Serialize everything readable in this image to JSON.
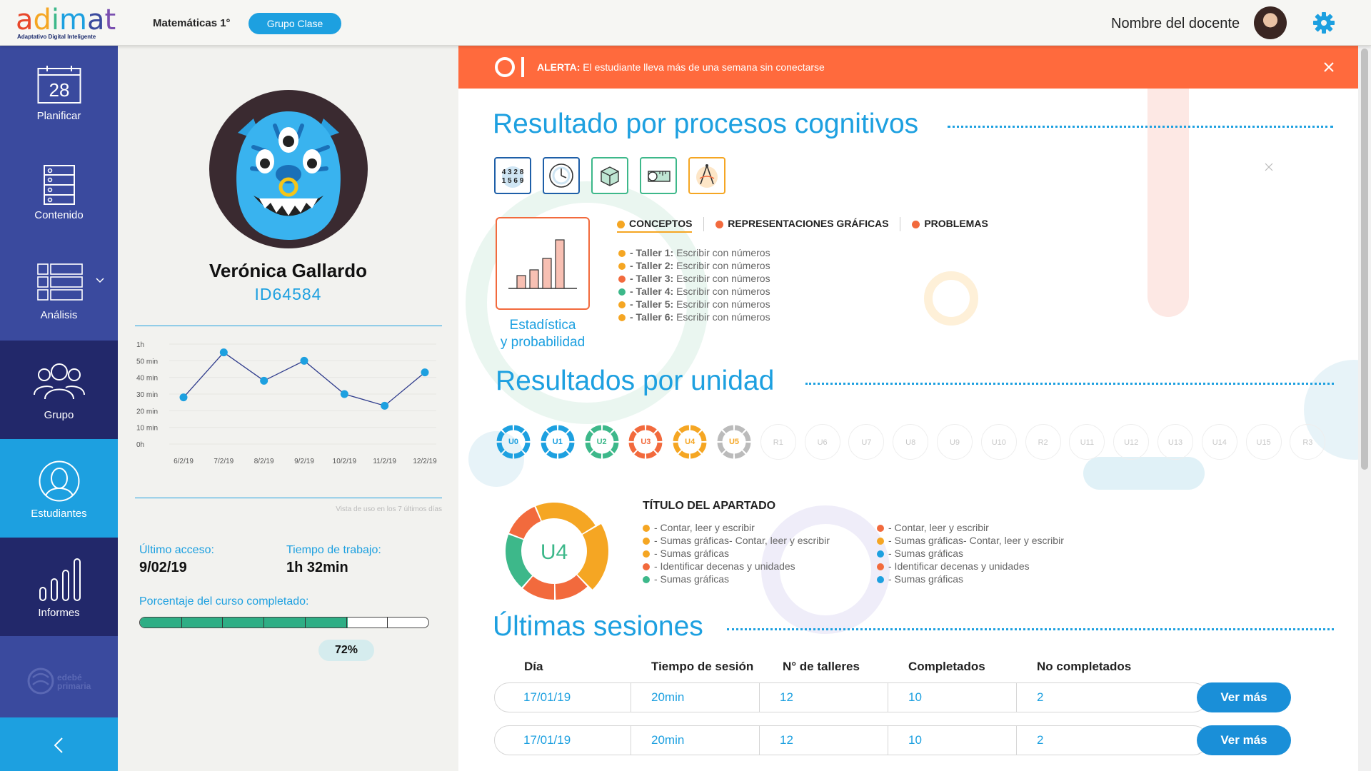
{
  "header": {
    "logo_word": "adimat",
    "logo_sub": "Adaptativo Digital Inteligente",
    "course": "Matemáticas 1°",
    "group_button": "Grupo Clase",
    "teacher_name": "Nombre del docente"
  },
  "sidebar": {
    "items": [
      {
        "label": "Planificar",
        "icon": "calendar-icon",
        "day": "28"
      },
      {
        "label": "Contenido",
        "icon": "cabinet-icon"
      },
      {
        "label": "Análisis",
        "icon": "table-grid-icon"
      },
      {
        "label": "Grupo",
        "icon": "group-icon"
      },
      {
        "label": "Estudiantes",
        "icon": "student-icon"
      },
      {
        "label": "Informes",
        "icon": "bar-chart-icon"
      }
    ],
    "brand": "edebé primaria",
    "colors": {
      "primary": "#3a4a9e",
      "dark": "#22286a",
      "active": "#1da0e0"
    }
  },
  "student": {
    "name": "Verónica Gallardo",
    "id": "ID64584",
    "last_access_label": "Último acceso:",
    "last_access_value": "9/02/19",
    "work_time_label": "Tiempo de trabajo:",
    "work_time_value": "1h 32min",
    "course_completed_label": "Porcentaje del curso completado:",
    "course_completed_pct": 72,
    "course_completed_text": "72%"
  },
  "chart_data": {
    "type": "line",
    "x": [
      "6/2/19",
      "7/2/19",
      "8/2/19",
      "9/2/19",
      "10/2/19",
      "11/2/19",
      "12/2/19"
    ],
    "values": [
      28,
      55,
      38,
      50,
      30,
      23,
      43
    ],
    "y_ticks": [
      "1h",
      "50 min",
      "40 min",
      "30 min",
      "20 min",
      "10 min",
      "0h"
    ],
    "ylim": [
      0,
      60
    ],
    "caption": "Vista de uso en los 7 últimos días",
    "color": "#1da0e0"
  },
  "alert": {
    "label": "ALERTA:",
    "text": "El estudiante lleva más de una semana sin conectarse"
  },
  "cognitive": {
    "title": "Resultado por procesos cognitivos",
    "icons": [
      "numbers-icon",
      "clock-icon",
      "cube-icon",
      "measuring-tape-icon",
      "compass-icon"
    ],
    "card_label_1": "Estadística",
    "card_label_2": "y probabilidad",
    "tabs": [
      {
        "label": "CONCEPTOS",
        "color": "#f5a623"
      },
      {
        "label": "REPRESENTACIONES GRÁFICAS",
        "color": "#f26a3d"
      },
      {
        "label": "PROBLEMAS",
        "color": "#f26a3d"
      }
    ],
    "talleres": [
      {
        "bold": "- Taller 1:",
        "text": " Escribir con números",
        "color": "#f5a623"
      },
      {
        "bold": "- Taller 2:",
        "text": " Escribir con números",
        "color": "#f5a623"
      },
      {
        "bold": "- Taller 3:",
        "text": " Escribir con números",
        "color": "#f26a3d"
      },
      {
        "bold": "- Taller 4:",
        "text": " Escribir con números",
        "color": "#3db88a"
      },
      {
        "bold": "- Taller 5:",
        "text": " Escribir con números",
        "color": "#f5a623"
      },
      {
        "bold": "- Taller 6:",
        "text": " Escribir con números",
        "color": "#f5a623"
      }
    ]
  },
  "units": {
    "title": "Resultados por unidad",
    "active": [
      {
        "label": "U0",
        "color": "#1da0e0"
      },
      {
        "label": "U1",
        "color": "#1da0e0"
      },
      {
        "label": "U2",
        "color": "#3db88a"
      },
      {
        "label": "U3",
        "color": "#f26a3d"
      },
      {
        "label": "U4",
        "color": "#f5a623"
      },
      {
        "label": "U5",
        "color": "#bbbbbb"
      }
    ],
    "inactive": [
      "R1",
      "U6",
      "U7",
      "U8",
      "U9",
      "U10",
      "R2",
      "U11",
      "U12",
      "U13",
      "U14",
      "U15",
      "R3"
    ],
    "selected": "U4",
    "section_title": "TÍTULO DEL APARTADO",
    "col1": [
      {
        "text": "- Contar, leer y escribir",
        "color": "#f5a623"
      },
      {
        "text": "- Sumas gráficas- Contar, leer y escribir",
        "color": "#f5a623"
      },
      {
        "text": "- Sumas gráficas",
        "color": "#f5a623"
      },
      {
        "text": "- Identificar decenas y unidades",
        "color": "#f26a3d"
      },
      {
        "text": "- Sumas gráficas",
        "color": "#3db88a"
      }
    ],
    "col2": [
      {
        "text": "- Contar, leer y escribir",
        "color": "#f26a3d"
      },
      {
        "text": "- Sumas gráficas- Contar, leer y escribir",
        "color": "#f5a623"
      },
      {
        "text": "- Sumas gráficas",
        "color": "#1da0e0"
      },
      {
        "text": "- Identificar decenas y unidades",
        "color": "#f26a3d"
      },
      {
        "text": "- Sumas gráficas",
        "color": "#1da0e0"
      }
    ]
  },
  "sessions": {
    "title": "Últimas sesiones",
    "headers": [
      "Día",
      "Tiempo de sesión",
      "N° de talleres",
      "Completados",
      "No completados"
    ],
    "rows": [
      {
        "day": "17/01/19",
        "time": "20min",
        "talleres": "12",
        "completed": "10",
        "not_completed": "2",
        "button": "Ver más"
      },
      {
        "day": "17/01/19",
        "time": "20min",
        "talleres": "12",
        "completed": "10",
        "not_completed": "2",
        "button": "Ver más"
      }
    ]
  }
}
